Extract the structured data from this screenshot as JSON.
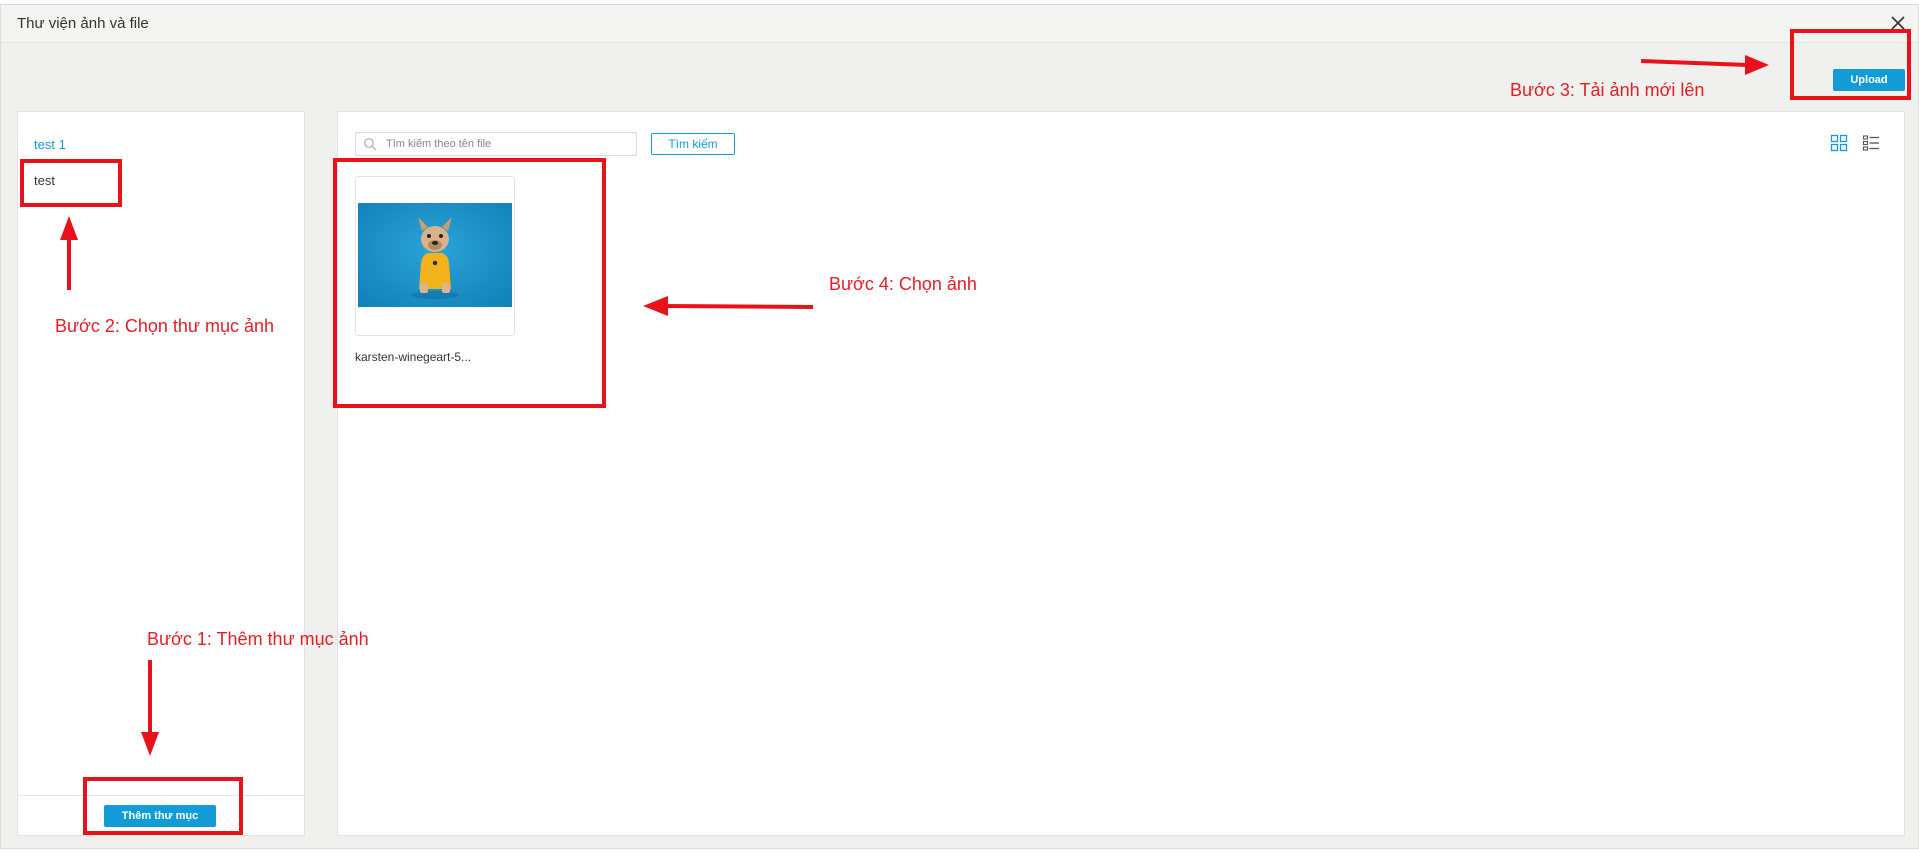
{
  "dialog": {
    "title": "Thư viện ảnh và file"
  },
  "toolbar": {
    "upload_label": "Upload"
  },
  "sidebar": {
    "folders": [
      {
        "label": "test 1",
        "active": true
      },
      {
        "label": "test",
        "active": false
      }
    ],
    "add_folder_label": "Thêm thư mục"
  },
  "search": {
    "placeholder": "Tìm kiếm theo tên file",
    "button_label": "Tìm kiếm"
  },
  "view_modes": [
    "grid-view-icon",
    "list-view-icon"
  ],
  "files": [
    {
      "name": "karsten-winegeart-5..."
    }
  ],
  "annotations": {
    "step1": "Bước 1: Thêm thư mục ảnh",
    "step2": "Bước 2: Chọn thư mục ảnh",
    "step3": "Bước 3: Tải ảnh mới lên",
    "step4": "Bước 4: Chọn ảnh",
    "color": "#e8121a"
  },
  "colors": {
    "accent": "#139bd8",
    "background": "#f0f0ee"
  }
}
